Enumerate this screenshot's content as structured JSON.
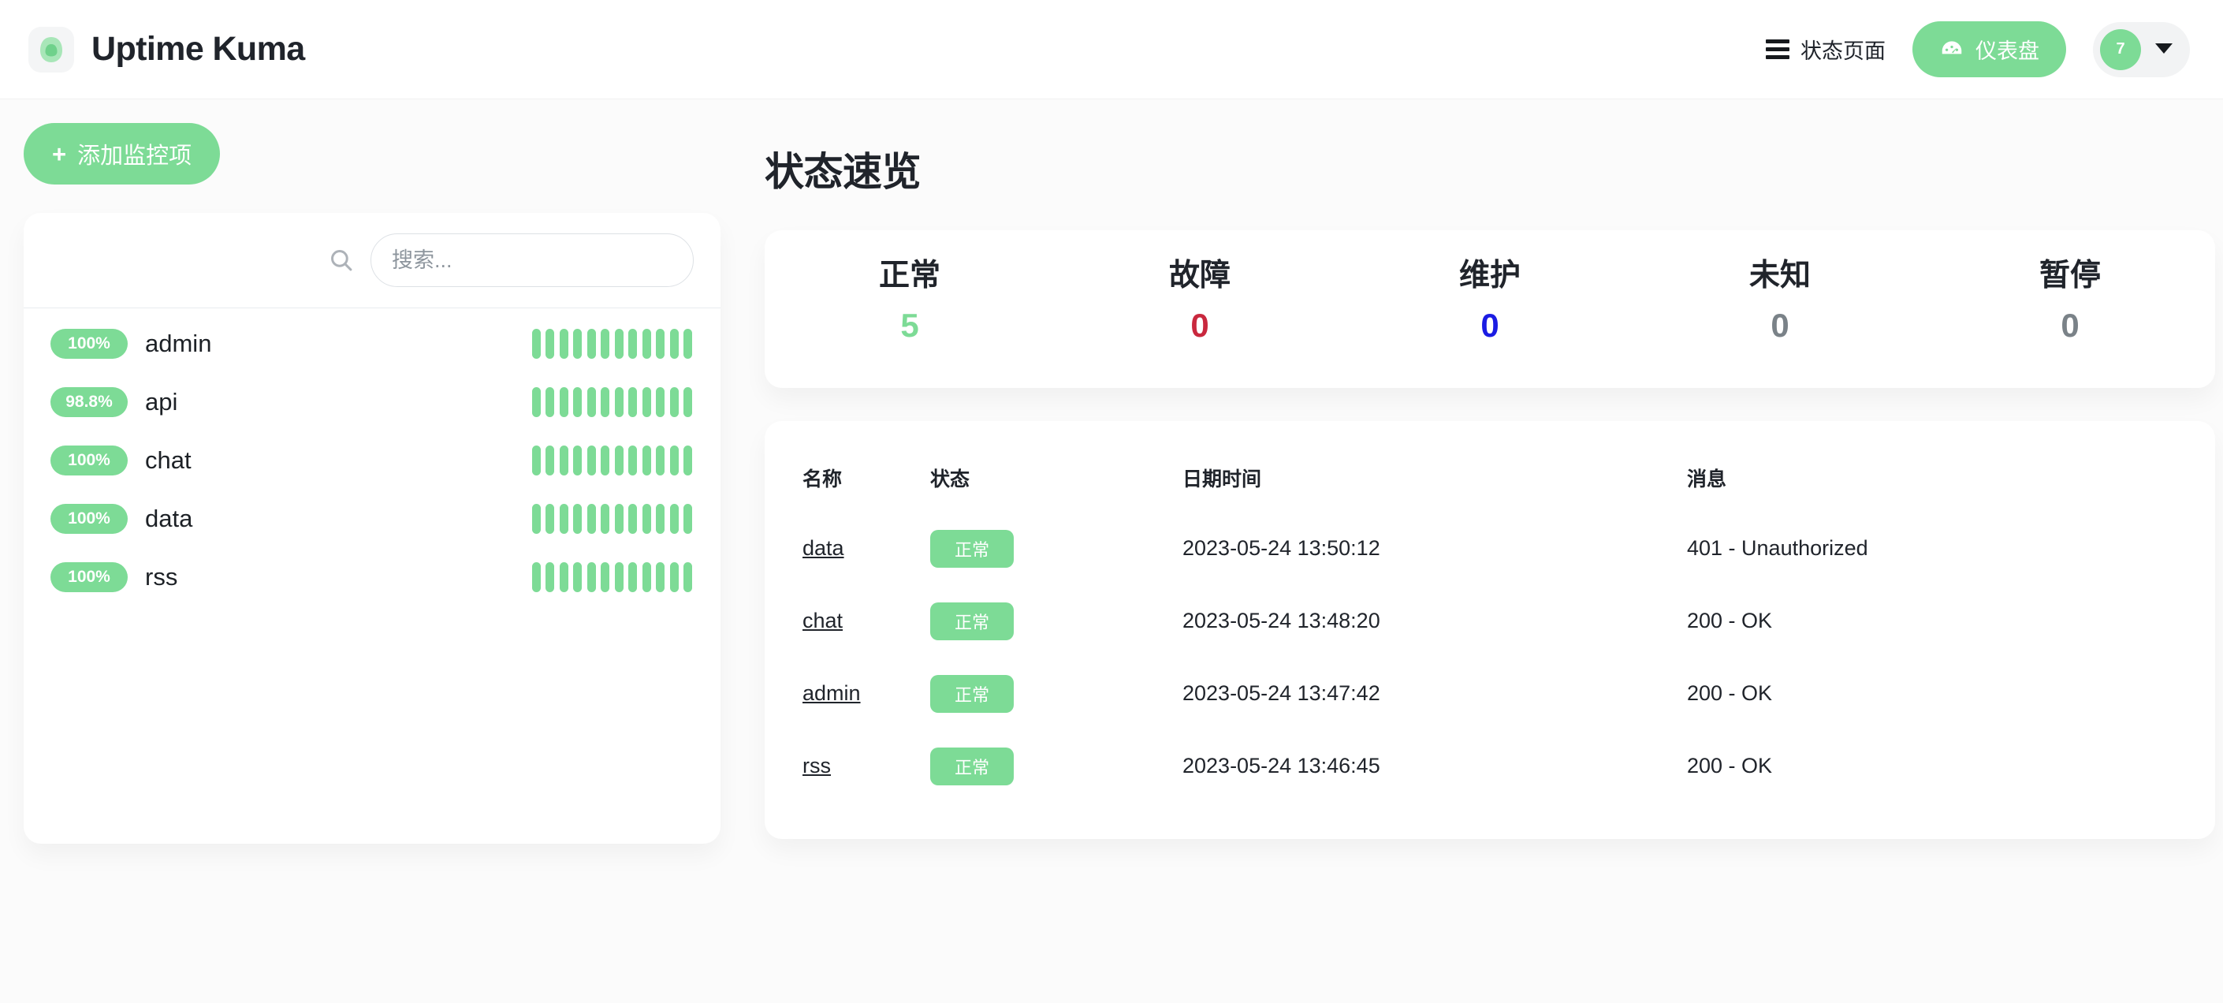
{
  "header": {
    "brand_title": "Uptime Kuma",
    "logo_icon": "kuma-logo-icon",
    "status_page_label": "状态页面",
    "status_page_icon": "hamburger-icon",
    "dashboard_label": "仪表盘",
    "dashboard_icon": "gauge-icon",
    "avatar_initial": "7",
    "chevron_icon": "chevron-down-icon"
  },
  "sidebar": {
    "add_monitor_label": "添加监控项",
    "add_monitor_icon": "plus-icon",
    "search_icon": "search-icon",
    "search_placeholder": "搜索...",
    "search_value": "",
    "monitors": [
      {
        "uptime": "100%",
        "name": "admin",
        "beats": [
          "up",
          "up",
          "up",
          "up",
          "up",
          "up",
          "up",
          "up",
          "up",
          "up",
          "up",
          "up"
        ]
      },
      {
        "uptime": "98.8%",
        "name": "api",
        "beats": [
          "up",
          "up",
          "up",
          "up",
          "up",
          "up",
          "up",
          "up",
          "up",
          "up",
          "up",
          "up"
        ]
      },
      {
        "uptime": "100%",
        "name": "chat",
        "beats": [
          "up",
          "up",
          "up",
          "up",
          "up",
          "up",
          "up",
          "up",
          "up",
          "up",
          "up",
          "up"
        ]
      },
      {
        "uptime": "100%",
        "name": "data",
        "beats": [
          "up",
          "up",
          "up",
          "up",
          "up",
          "up",
          "up",
          "up",
          "up",
          "up",
          "up",
          "up"
        ]
      },
      {
        "uptime": "100%",
        "name": "rss",
        "beats": [
          "up",
          "up",
          "up",
          "up",
          "up",
          "up",
          "up",
          "up",
          "up",
          "up",
          "up",
          "up"
        ]
      }
    ]
  },
  "main": {
    "page_title": "状态速览",
    "stats": [
      {
        "label": "正常",
        "value": "5",
        "color": "#7ddb96"
      },
      {
        "label": "故障",
        "value": "0",
        "color": "#c9283e"
      },
      {
        "label": "维护",
        "value": "0",
        "color": "#1b1ce3"
      },
      {
        "label": "未知",
        "value": "0",
        "color": "#7a8288"
      },
      {
        "label": "暂停",
        "value": "0",
        "color": "#7a8288"
      }
    ],
    "events": {
      "columns": {
        "name": "名称",
        "status": "状态",
        "datetime": "日期时间",
        "message": "消息"
      },
      "rows": [
        {
          "name": "data",
          "status": "正常",
          "status_kind": "up",
          "datetime": "2023-05-24 13:50:12",
          "message": "401 - Unauthorized"
        },
        {
          "name": "chat",
          "status": "正常",
          "status_kind": "up",
          "datetime": "2023-05-24 13:48:20",
          "message": "200 - OK"
        },
        {
          "name": "admin",
          "status": "正常",
          "status_kind": "up",
          "datetime": "2023-05-24 13:47:42",
          "message": "200 - OK"
        },
        {
          "name": "rss",
          "status": "正常",
          "status_kind": "up",
          "datetime": "2023-05-24 13:46:45",
          "message": "200 - OK"
        }
      ]
    }
  },
  "colors": {
    "accent_green": "#7ddb96",
    "danger_red": "#c9283e",
    "maintenance_blue": "#1b1ce3",
    "muted_gray": "#7a8288"
  }
}
